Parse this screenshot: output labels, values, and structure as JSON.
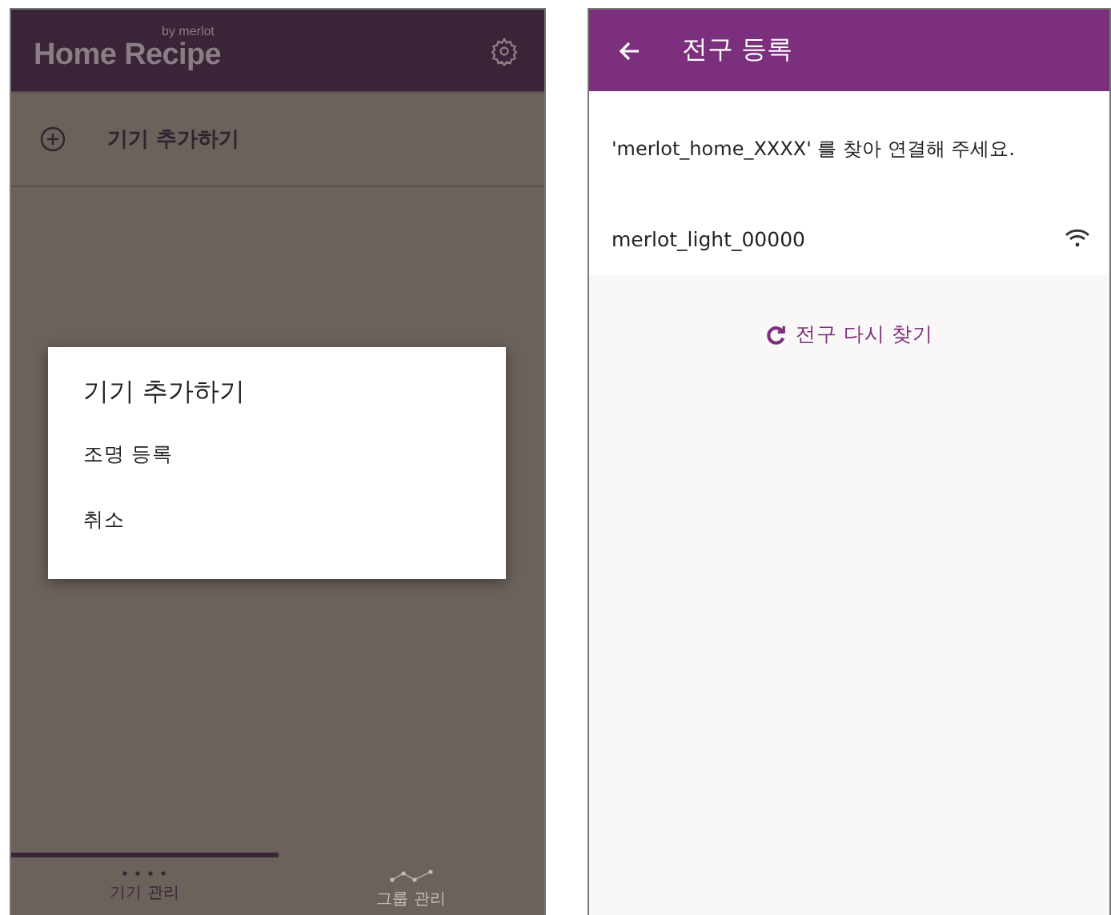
{
  "left_screen": {
    "app_bar": {
      "title": "Home Recipe",
      "subtitle": "by merlot"
    },
    "add_device_row": {
      "label": "기기 추가하기"
    },
    "dialog": {
      "title": "기기 추가하기",
      "options": [
        "조명 등록",
        "취소"
      ]
    },
    "bottom_tabs": [
      {
        "label": "기기 관리",
        "kind": "devices",
        "selected": true
      },
      {
        "label": "그룹 관리",
        "kind": "groups",
        "selected": false
      }
    ]
  },
  "right_screen": {
    "app_bar": {
      "title": "전구 등록"
    },
    "message": "'merlot_home_XXXX' 를 찾아 연결해 주세요.",
    "networks": [
      {
        "name": "merlot_light_00000"
      }
    ],
    "rescan_button": {
      "label": "전구 다시 찾기"
    }
  }
}
